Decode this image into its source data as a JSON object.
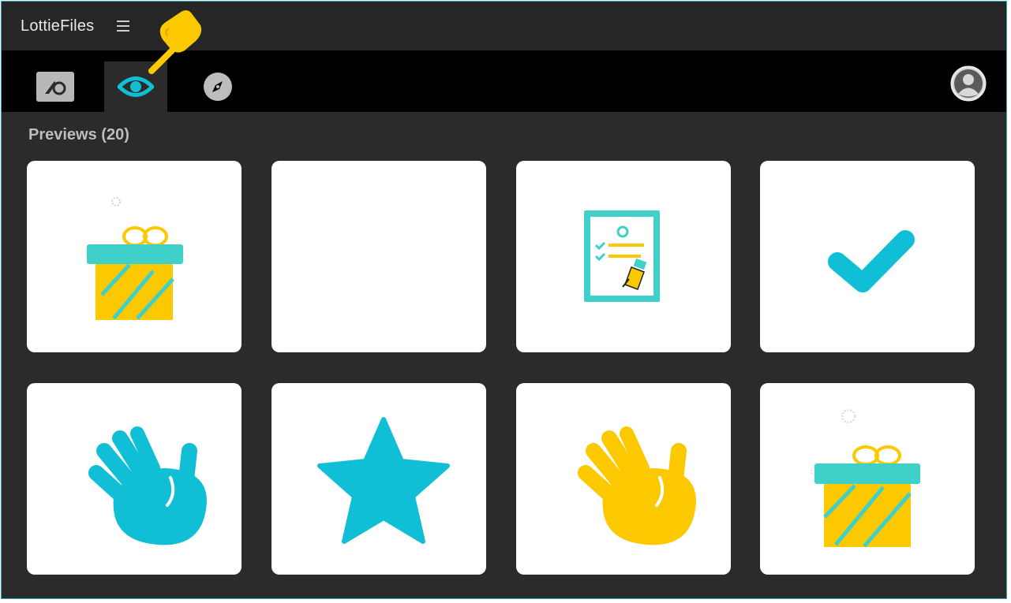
{
  "app": {
    "title": "LottieFiles"
  },
  "tabs": [
    {
      "icon": "lottie-logo-icon",
      "active": false
    },
    {
      "icon": "eye-icon",
      "active": true
    },
    {
      "icon": "compass-icon",
      "active": false
    }
  ],
  "previews": {
    "title": "Previews (20)",
    "items": [
      {
        "icon": "gift-box-icon"
      },
      {
        "icon": "blank"
      },
      {
        "icon": "signed-document-icon"
      },
      {
        "icon": "checkmark-icon"
      },
      {
        "icon": "waving-hand-icon",
        "color": "#10bfd6"
      },
      {
        "icon": "star-icon",
        "color": "#10bfd6"
      },
      {
        "icon": "waving-hand-icon",
        "color": "#fcc900"
      },
      {
        "icon": "gift-box-icon"
      }
    ]
  },
  "colors": {
    "accent_cyan": "#10bfd6",
    "accent_yellow": "#fcc900",
    "teal": "#3fd0c9",
    "background": "#2b2b2b",
    "tabbar": "#000000"
  }
}
